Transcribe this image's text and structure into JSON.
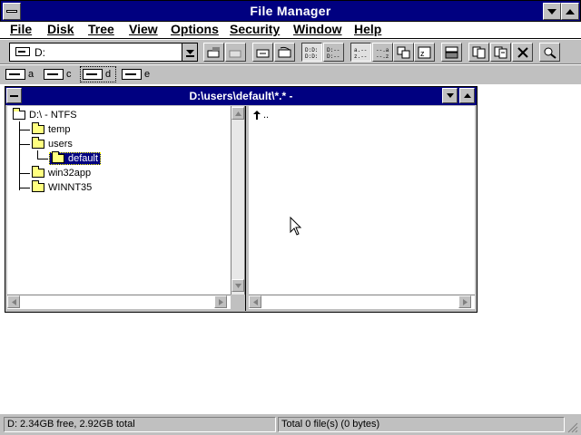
{
  "app": {
    "title": "File Manager"
  },
  "menu": [
    "File",
    "Disk",
    "Tree",
    "View",
    "Options",
    "Security",
    "Window",
    "Help"
  ],
  "toolbar": {
    "drive_combo_value": "D:",
    "buttons": [
      "connect-network-drive",
      "disconnect-network-drive",
      "share-as",
      "stop-sharing",
      "view-name",
      "view-all-details",
      "sort-by-name",
      "sort-by-type",
      "sort-by-size",
      "sort-by-date",
      "new-window",
      "copy",
      "move",
      "delete",
      "properties"
    ]
  },
  "drives": [
    {
      "letter": "a",
      "selected": false
    },
    {
      "letter": "c",
      "selected": false
    },
    {
      "letter": "d",
      "selected": true
    },
    {
      "letter": "e",
      "selected": false
    }
  ],
  "child_window": {
    "title": "D:\\users\\default\\*.* -",
    "tree": [
      {
        "label": "D:\\ - NTFS",
        "level": 0,
        "type": "drive-root"
      },
      {
        "label": "temp",
        "level": 1,
        "type": "folder"
      },
      {
        "label": "users",
        "level": 1,
        "type": "folder"
      },
      {
        "label": "default",
        "level": 2,
        "type": "folder-open",
        "selected": true
      },
      {
        "label": "win32app",
        "level": 1,
        "type": "folder"
      },
      {
        "label": "WINNT35",
        "level": 1,
        "type": "folder"
      }
    ],
    "dir_items": [
      {
        "label": "..",
        "type": "up-arrow"
      }
    ]
  },
  "status": {
    "left": "D: 2.34GB free,  2.92GB total",
    "right": "Total 0 file(s) (0 bytes)"
  },
  "colors": {
    "titlebar": "#000080",
    "face": "#c0c0c0",
    "selection": "#000080"
  }
}
